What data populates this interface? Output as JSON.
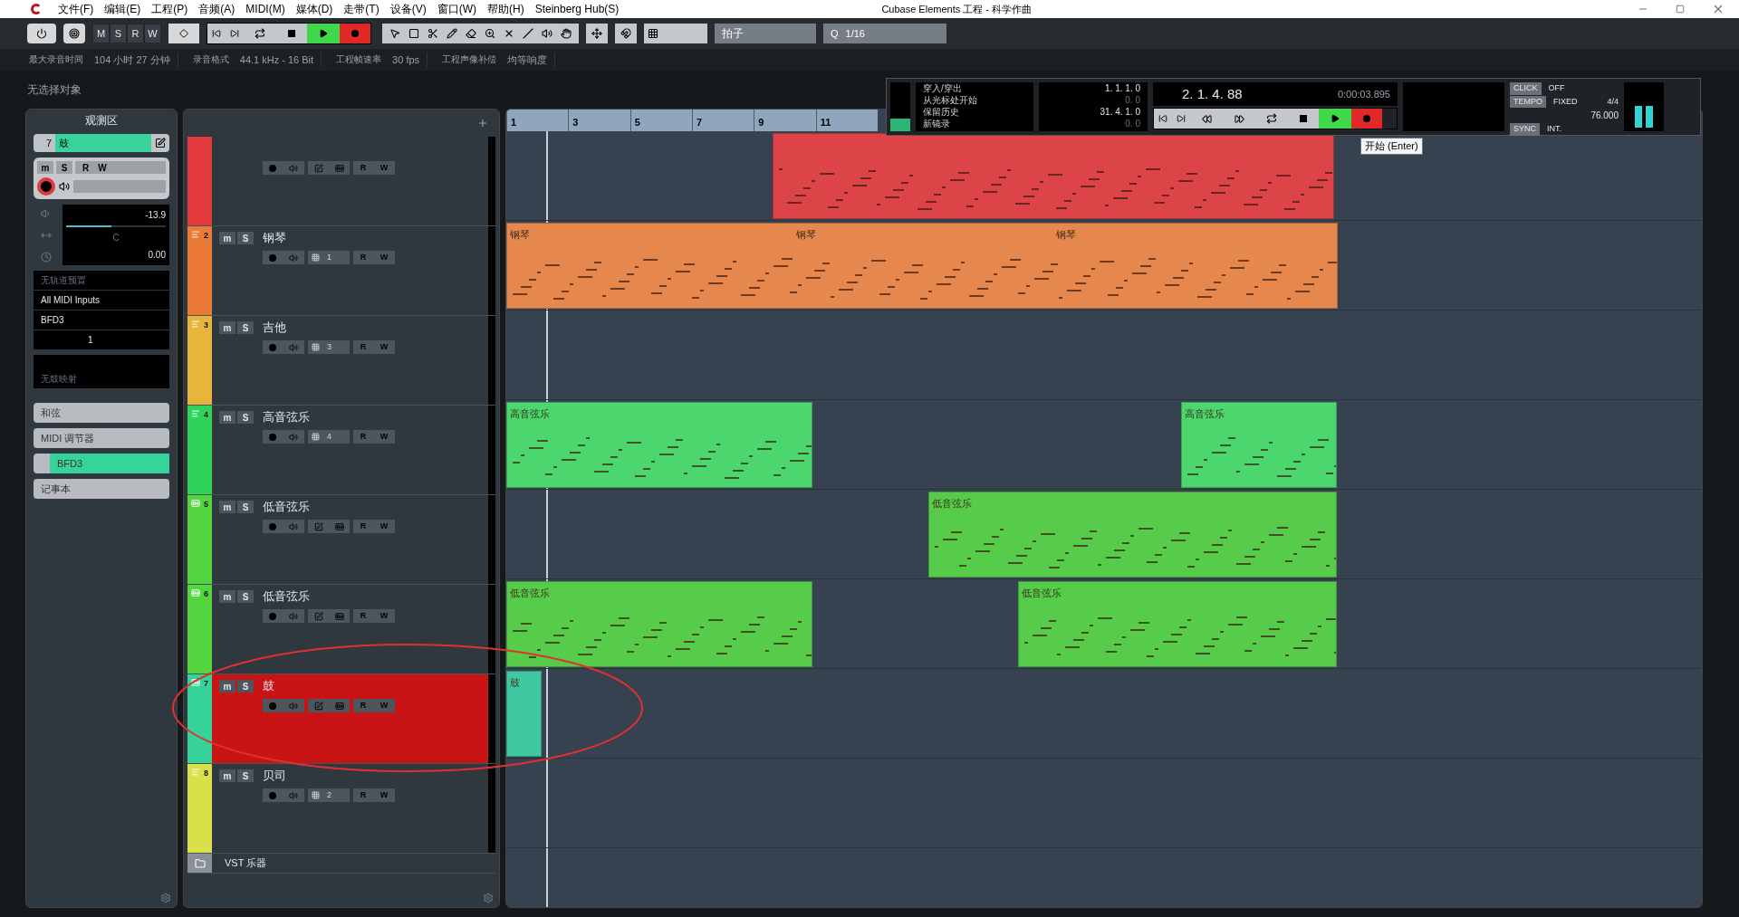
{
  "window": {
    "title": "Cubase Elements 工程 - 科学作曲"
  },
  "menu": [
    "文件(F)",
    "编辑(E)",
    "工程(P)",
    "音频(A)",
    "MIDI(M)",
    "媒体(D)",
    "走带(T)",
    "设备(V)",
    "窗口(W)",
    "帮助(H)",
    "Steinberg Hub(S)"
  ],
  "toolbar": {
    "msrw": [
      "M",
      "S",
      "R",
      "W"
    ],
    "grid_type": "拍子",
    "quantize_label": "Q",
    "quantize": "1/16"
  },
  "status_bar": [
    {
      "label": "最大录音时间",
      "value": "104 小时 27 分钟"
    },
    {
      "label": "录音格式",
      "value": "44.1 kHz - 16 Bit"
    },
    {
      "label": "工程帧速率",
      "value": "30 fps"
    },
    {
      "label": "工程声像补偿",
      "value": "均等响度"
    }
  ],
  "info_line": "无选择对象",
  "inspector": {
    "title": "观测区",
    "track_number": "7",
    "track_name": "鼓",
    "ms": [
      "m",
      "S"
    ],
    "rw": [
      "R",
      "W"
    ],
    "record_on": true,
    "volume": "-13.9",
    "volume_fader": {
      "level": 0.45
    },
    "pan": "C",
    "delay": "0.00",
    "preset": "无轨道预置",
    "input": "All MIDI Inputs",
    "output": "BFD3",
    "channel": "1",
    "drum_map": "无鼓映射",
    "sections": [
      {
        "kind": "plain",
        "label": "和弦"
      },
      {
        "kind": "plain",
        "label": "MIDI 调节器"
      },
      {
        "kind": "instrument",
        "label": "BFD3"
      },
      {
        "kind": "plain",
        "label": "记事本"
      }
    ]
  },
  "tracks": [
    {
      "kind": "instrument",
      "rw": [
        "R",
        "W"
      ],
      "color": "#e23a3a",
      "selected": false,
      "clips": [
        {
          "color": "#dd4448"
        }
      ]
    },
    {
      "number": "2",
      "name": "钢琴",
      "ms": [
        "m",
        "S"
      ],
      "rw": [
        "R",
        "W"
      ],
      "kind": "midi",
      "channel": "1",
      "color": "#ea7a35",
      "selected": false,
      "clips": [
        {
          "label": "钢琴",
          "color": "#e6874e",
          "extra_labels": [
            "钢琴",
            "钢琴"
          ]
        }
      ]
    },
    {
      "number": "3",
      "name": "吉他",
      "ms": [
        "m",
        "S"
      ],
      "rw": [
        "R",
        "W"
      ],
      "kind": "midi",
      "channel": "3",
      "color": "#e8b53a",
      "selected": false
    },
    {
      "number": "4",
      "name": "高音弦乐",
      "ms": [
        "m",
        "S"
      ],
      "rw": [
        "R",
        "W"
      ],
      "kind": "midi",
      "channel": "4",
      "color": "#2fd35a",
      "selected": false,
      "clips": [
        {
          "label": "高音弦乐",
          "color": "#4cd66e"
        },
        {
          "label": "高音弦乐",
          "color": "#4cd66e"
        }
      ]
    },
    {
      "number": "5",
      "name": "低音弦乐",
      "ms": [
        "m",
        "S"
      ],
      "rw": [
        "R",
        "W"
      ],
      "kind": "instrument",
      "color": "#52d53e",
      "selected": false,
      "clips": [
        {
          "label": "低音弦乐",
          "color": "#56cc4a"
        }
      ]
    },
    {
      "number": "6",
      "name": "低音弦乐",
      "ms": [
        "m",
        "S"
      ],
      "rw": [
        "R",
        "W"
      ],
      "kind": "instrument",
      "color": "#52d53e",
      "selected": false,
      "clips": [
        {
          "label": "低音弦乐",
          "color": "#56cc4a"
        },
        {
          "label": "低音弦乐",
          "color": "#56cc4a"
        }
      ]
    },
    {
      "number": "7",
      "name": "鼓",
      "ms": [
        "m",
        "S"
      ],
      "rw": [
        "R",
        "W"
      ],
      "kind": "instrument",
      "color": "#35d39a",
      "selected": true,
      "clips": [
        {
          "label": "鼓",
          "color": "#3ec9a0"
        }
      ]
    },
    {
      "number": "8",
      "name": "贝司",
      "ms": [
        "m",
        "S"
      ],
      "rw": [
        "R",
        "W"
      ],
      "kind": "midi",
      "channel": "2",
      "color": "#d8e04a",
      "selected": false
    }
  ],
  "folder_track": "VST 乐器",
  "ruler": [
    "1",
    "3",
    "5",
    "7",
    "9",
    "11"
  ],
  "transport": {
    "punch": [
      "穿入/穿出",
      "从光标处开始",
      "保留历史",
      "新镜录"
    ],
    "left_locator": "1. 1. 1. 0",
    "left_offset": "0. 0",
    "right_locator": "31. 4. 1. 0",
    "right_offset": "0. 0",
    "position": "2. 1. 4. 88",
    "time": "0:00:03.895",
    "click_label": "CLICK",
    "click": "OFF",
    "tempo_label": "TEMPO",
    "tempo_mode": "FIXED",
    "signature": "4/4",
    "tempo": "76.000",
    "sync_label": "SYNC",
    "sync": "INT.",
    "tooltip": "开始 (Enter)"
  }
}
